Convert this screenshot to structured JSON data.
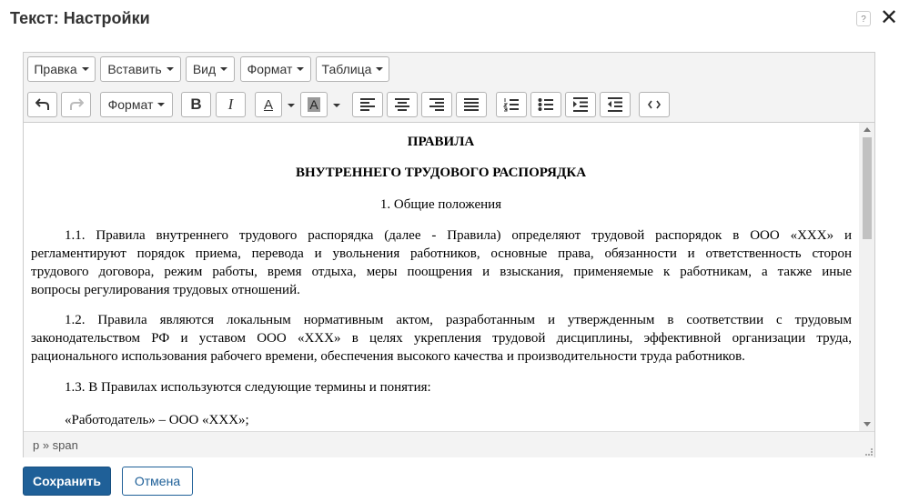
{
  "dialog": {
    "title": "Текст: Настройки",
    "help_label": "?",
    "close_label": "✕"
  },
  "menubar": {
    "items": [
      {
        "label": "Правка"
      },
      {
        "label": "Вставить"
      },
      {
        "label": "Вид"
      },
      {
        "label": "Формат"
      },
      {
        "label": "Таблица"
      }
    ]
  },
  "toolbar": {
    "format_label": "Формат",
    "bold_label": "B",
    "italic_label": "I",
    "text_color_label": "A",
    "bg_color_label": "A",
    "icons": [
      "undo-icon",
      "redo-icon",
      "align-left-icon",
      "align-center-icon",
      "align-right-icon",
      "align-justify-icon",
      "numbered-list-icon",
      "bullet-list-icon",
      "indent-icon",
      "outdent-icon",
      "source-code-icon"
    ]
  },
  "document": {
    "heading1": "ПРАВИЛА",
    "heading2": "ВНУТРЕННЕГО ТРУДОВОГО РАСПОРЯДКА",
    "section": "1. Общие положения",
    "p1": {
      "l1": "1.1. Правила внутреннего трудового распорядка (далее - Правила) определяют трудовой распорядок в ООО «ХХХ» и",
      "l2": "регламентируют порядок приема, перевода и увольнения работников, основные права, обязанности и ответственность сторон",
      "l3": "трудового договора, режим работы, время отдыха, меры поощрения и взыскания, применяемые к работникам, а также иные",
      "l4": "вопросы регулирования трудовых отношений."
    },
    "p2": {
      "l1": "1.2. Правила являются локальным нормативным актом, разработанным и утвержденным в соответствии с трудовым",
      "l2": "законодательством РФ и уставом ООО «ХХХ» в целях укрепления трудовой дисциплины, эффективной организации труда,",
      "l3": "рационального использования рабочего времени, обеспечения высокого качества и производительности труда работников."
    },
    "p3": "1.3. В Правилах используются следующие термины и понятия:",
    "p4": "«Работодатель» – ООО «ХХХ»;"
  },
  "statusbar": {
    "path": "p » span"
  },
  "footer": {
    "save_label": "Сохранить",
    "cancel_label": "Отмена"
  },
  "colors": {
    "primary": "#1f6098",
    "toolbar_bg": "#f3f3f3",
    "border": "#cccccc"
  }
}
